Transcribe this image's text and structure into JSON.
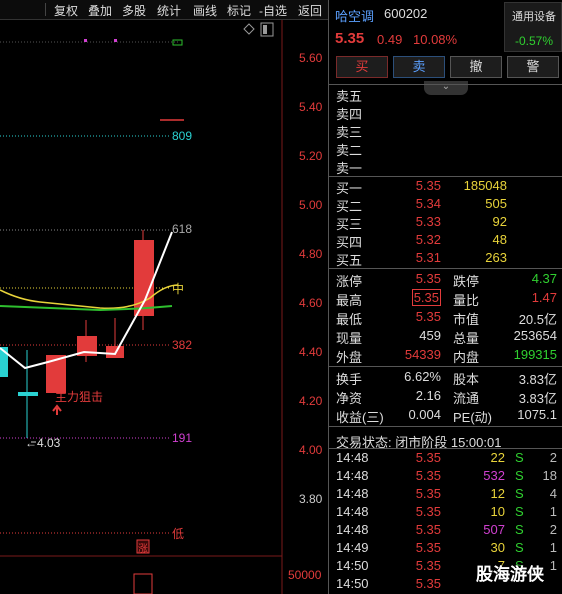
{
  "toolbar": {
    "items": [
      "复权",
      "叠加",
      "多股",
      "统计",
      "画线",
      "标记",
      "-自选",
      "返回"
    ]
  },
  "chart": {
    "price_ticks": [
      "5.60",
      "5.40",
      "5.20",
      "5.00",
      "4.80",
      "4.60",
      "4.40",
      "4.20",
      "4.00",
      "3.80"
    ],
    "volume_tick": "50000",
    "fib_labels": {
      "l809": "809",
      "l618": "618",
      "l382": "382",
      "l191": "191",
      "mid": "中",
      "low": "低"
    },
    "annotation_text": "主力狙击",
    "low_marker": "←4.03",
    "limit_up_badge": "涨"
  },
  "quote": {
    "name": "哈空调",
    "code": "600202",
    "sector": {
      "name": "通用设备",
      "change": "-0.57%"
    },
    "price": "5.35",
    "change": "0.49",
    "change_pct": "10.08%",
    "buttons": {
      "buy": "买",
      "sell": "卖",
      "cancel": "撤",
      "alert": "警"
    },
    "asks": [
      {
        "label": "卖五",
        "price": "",
        "vol": ""
      },
      {
        "label": "卖四",
        "price": "",
        "vol": ""
      },
      {
        "label": "卖三",
        "price": "",
        "vol": ""
      },
      {
        "label": "卖二",
        "price": "",
        "vol": ""
      },
      {
        "label": "卖一",
        "price": "",
        "vol": ""
      }
    ],
    "bids": [
      {
        "label": "买一",
        "price": "5.35",
        "vol": "185048"
      },
      {
        "label": "买二",
        "price": "5.34",
        "vol": "505"
      },
      {
        "label": "买三",
        "price": "5.33",
        "vol": "92"
      },
      {
        "label": "买四",
        "price": "5.32",
        "vol": "48"
      },
      {
        "label": "买五",
        "price": "5.31",
        "vol": "263"
      }
    ],
    "stats": [
      {
        "l": "涨停",
        "lv": "5.35",
        "r": "跌停",
        "rv": "4.37"
      },
      {
        "l": "最高",
        "lv": "5.35",
        "r": "量比",
        "rv": "1.47"
      },
      {
        "l": "最低",
        "lv": "5.35",
        "r": "市值",
        "rv": "20.5亿"
      },
      {
        "l": "现量",
        "lv": "459",
        "r": "总量",
        "rv": "253654"
      },
      {
        "l": "外盘",
        "lv": "54339",
        "r": "内盘",
        "rv": "199315"
      }
    ],
    "stats2": [
      {
        "l": "换手",
        "lv": "6.62%",
        "r": "股本",
        "rv": "3.83亿"
      },
      {
        "l": "净资",
        "lv": "2.16",
        "r": "流通",
        "rv": "3.83亿"
      },
      {
        "l": "收益(三)",
        "lv": "0.004",
        "r": "PE(动)",
        "rv": "1075.1"
      }
    ],
    "trade_status": "交易状态: 闭市阶段 15:00:01",
    "ticks": [
      {
        "time": "14:48",
        "price": "5.35",
        "vol": "22",
        "side": "S",
        "num": "2"
      },
      {
        "time": "14:48",
        "price": "5.35",
        "vol": "532",
        "side": "S",
        "num": "18"
      },
      {
        "time": "14:48",
        "price": "5.35",
        "vol": "12",
        "side": "S",
        "num": "4"
      },
      {
        "time": "14:48",
        "price": "5.35",
        "vol": "10",
        "side": "S",
        "num": "1"
      },
      {
        "time": "14:48",
        "price": "5.35",
        "vol": "507",
        "side": "S",
        "num": "2"
      },
      {
        "time": "14:49",
        "price": "5.35",
        "vol": "30",
        "side": "S",
        "num": "1"
      },
      {
        "time": "14:50",
        "price": "5.35",
        "vol": "7",
        "side": "S",
        "num": "1"
      },
      {
        "time": "14:50",
        "price": "5.35",
        "vol": "",
        "side": "",
        "num": ""
      }
    ]
  },
  "watermark": "股海游侠"
}
